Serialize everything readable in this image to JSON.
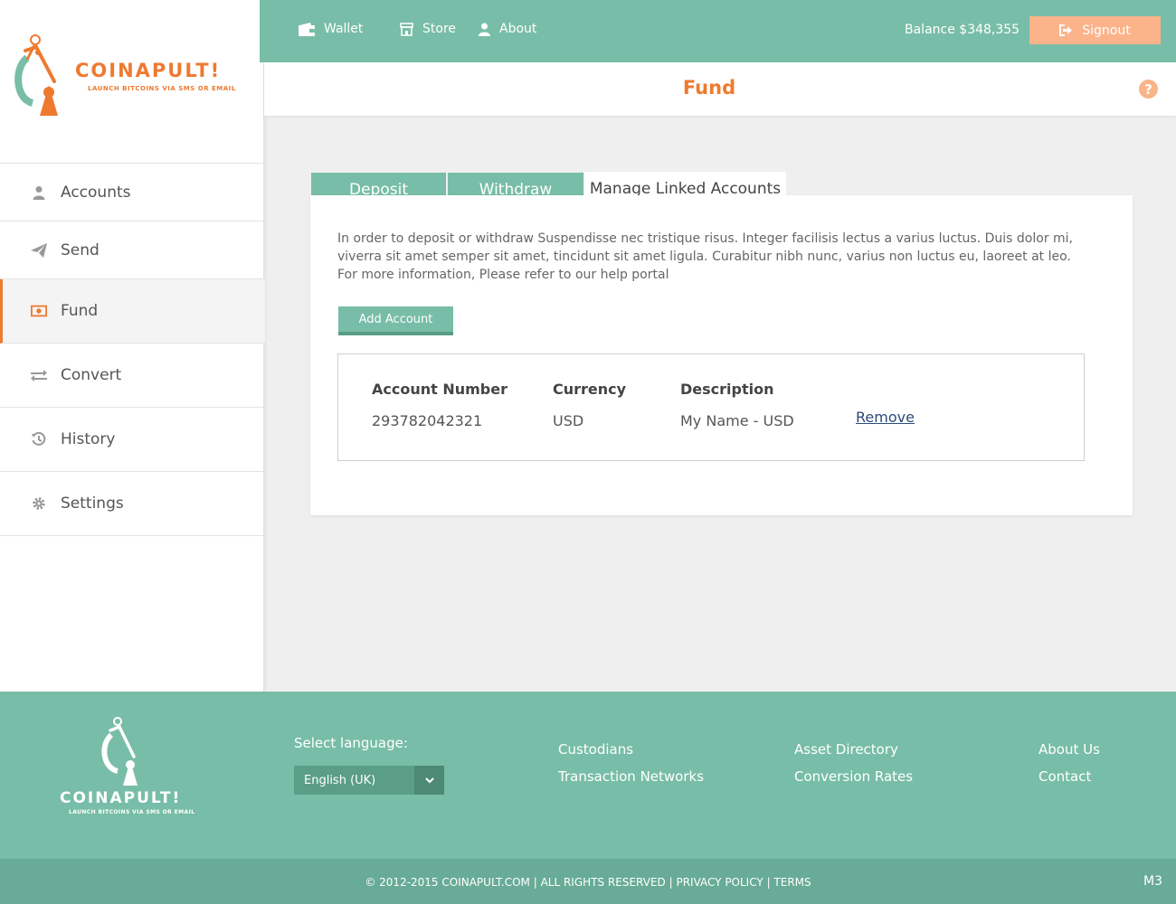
{
  "brand": {
    "name": "COINAPULT!",
    "tagline": "LAUNCH BITCOINS VIA SMS OR EMAIL"
  },
  "topnav": {
    "items": [
      {
        "label": "Wallet",
        "icon": "wallet-icon"
      },
      {
        "label": "Store",
        "icon": "store-icon"
      },
      {
        "label": "About",
        "icon": "user-icon"
      }
    ],
    "balance": "Balance $348,355",
    "signout_label": "Signout"
  },
  "sidebar": {
    "items": [
      {
        "label": "Accounts",
        "icon": "user-icon"
      },
      {
        "label": "Send",
        "icon": "paper-plane-icon"
      },
      {
        "label": "Fund",
        "icon": "money-icon",
        "active": true
      },
      {
        "label": "Convert",
        "icon": "exchange-icon"
      },
      {
        "label": "History",
        "icon": "history-icon"
      },
      {
        "label": "Settings",
        "icon": "gear-icon"
      }
    ]
  },
  "page": {
    "title": "Fund",
    "help_icon": "question-icon"
  },
  "tabs": [
    {
      "label": "Deposit",
      "active": false
    },
    {
      "label": "Withdraw",
      "active": false
    },
    {
      "label": "Manage Linked Accounts",
      "active": true
    }
  ],
  "content": {
    "intro": "In order to deposit or withdraw Suspendisse nec tristique risus. Integer facilisis lectus a varius luctus. Duis dolor mi, viverra sit amet semper sit amet, tincidunt sit amet ligula. Curabitur nibh nunc, varius non luctus eu, laoreet at leo. For more information, Please refer to our help portal",
    "add_account_label": "Add Account",
    "table": {
      "headers": [
        "Account Number",
        "Currency",
        "Description"
      ],
      "rows": [
        {
          "account_number": "293782042321",
          "currency": "USD",
          "description": "My Name - USD",
          "action": "Remove"
        }
      ]
    }
  },
  "footer": {
    "select_language_label": "Select language:",
    "language_value": "English (UK)",
    "links_col1": [
      "Custodians",
      "Transaction Networks"
    ],
    "links_col2": [
      "Asset Directory",
      "Conversion Rates"
    ],
    "links_col3": [
      "About Us",
      "Contact"
    ],
    "copyright": "© 2012-2015 COINAPULT.COM",
    "rights": "ALL RIGHTS RESERVED",
    "privacy": "PRIVACY POLICY",
    "terms": "TERMS",
    "version": "M3"
  },
  "colors": {
    "accent": "#ee7a30",
    "teal": "#78bda7",
    "signout": "#fbb38a"
  }
}
